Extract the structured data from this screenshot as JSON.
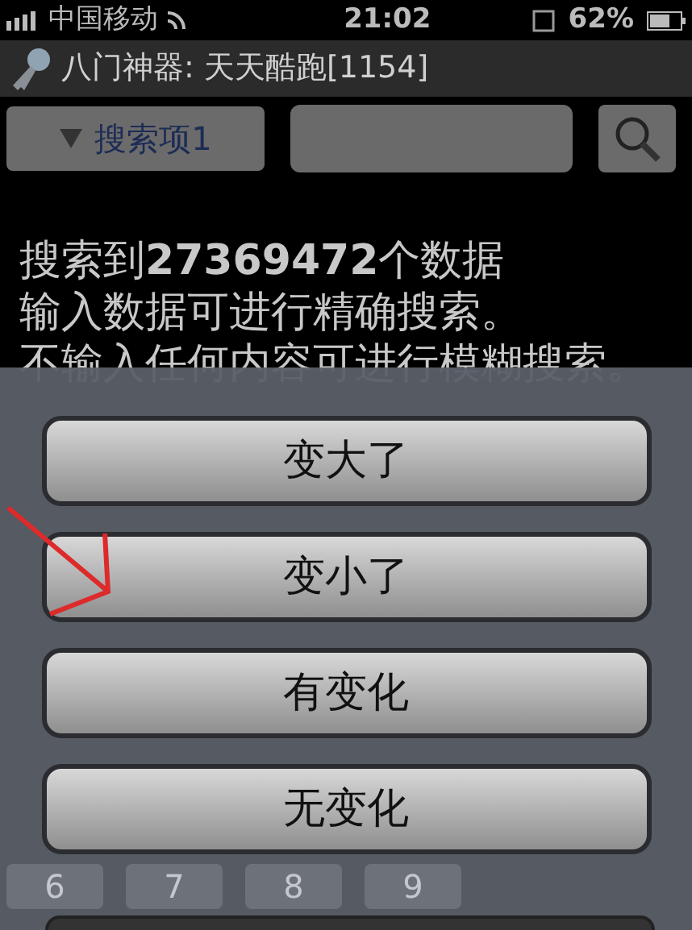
{
  "status_bar": {
    "carrier": "中国移动",
    "time": "21:02",
    "battery": "62%"
  },
  "title_bar": {
    "title": "八门神器: 天天酷跑[1154]"
  },
  "search": {
    "dropdown": "搜索项1"
  },
  "results": [
    "搜索到**27369472**个数据",
    "输入数据可进行精确搜索。",
    "不输入任何内容可进行模糊搜索。"
  ],
  "options": [
    "变大了",
    "变小了",
    "有变化",
    "无变化"
  ],
  "keyboard_keys": [
    "6",
    "7",
    "8",
    "9"
  ]
}
